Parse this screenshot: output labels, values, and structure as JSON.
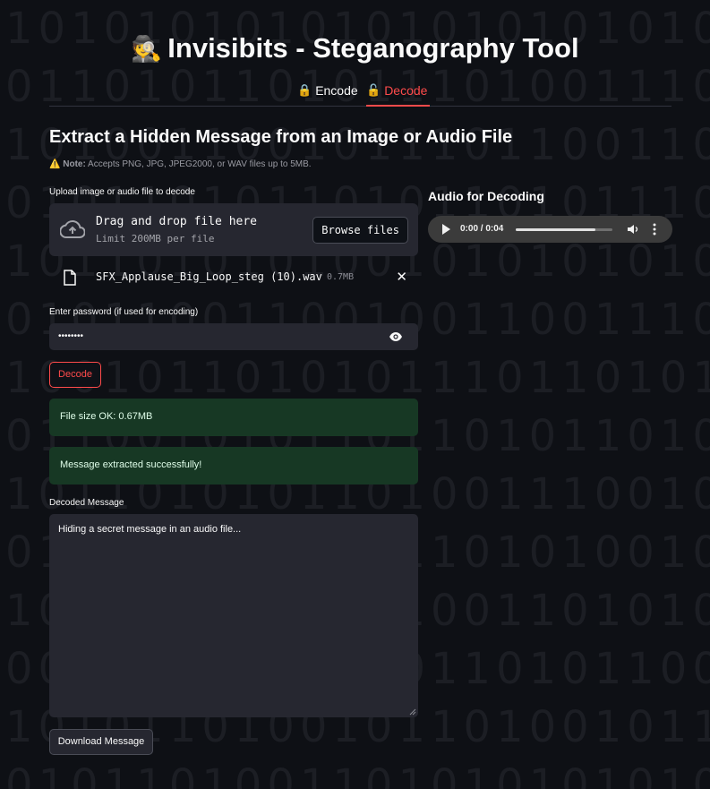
{
  "background_pattern": [
    "1 0 1 0 1 0 1 0 1 0 1 0 1 0 1 0 1 0 1 0 1 0 1",
    "0 1 1 0 1 0 1 1 0 1 0 1 1 1 0 1 0 0 1 1 1 0 1",
    "1 0 1 0 0 1 1 0 0 1 0 1 1 1 0 1 1 0 0 1 1 0 1",
    "0 1 0 1 1 0 1 0 1 1 0 1 0 1 1 0 1 0 1 1 1 0 0",
    "1 0 1 1 0 1 0 1 0 1 0 0 1 0 1 0 1 0 1 0 1 0 1",
    "0 1 0 1 1 0 0 1 1 0 0 1 0 0 1 1 0 0 1 1 1 0 0",
    "1 0 0 1 0 1 1 0 1 0 1 0 1 1 1 0 1 1 0 1 0 1 1",
    "0 1 1 0 0 1 0 1 0 1 1 0 1 1 0 1 0 1 1 0 1 0 1",
    "1 0 1 1 0 1 0 1 0 1 1 0 1 0 0 1 1 1 0 0 1 0 1",
    "0 1 0 1 1 0 1 0 1 0 1 0 1 1 0 1 0 1 0 0 1 0 1",
    "1 0 0 0 1 1 1 0 1 0 1 0 1 0 0 1 1 0 1 0 1 0 1",
    "0 0 1 0 1 0 1 0 1 1 0 1 0 1 1 0 1 0 1 1 0 0 1",
    "1 0 1 0 1 1 0 1 0 0 1 0 1 1 0 1 0 0 1 0 1 1 1",
    "0 1 0 1 1 0 1 0 0 1 1 0 1 0 1 0 1 0 1 0 1 0 1"
  ],
  "header": {
    "emoji": "🕵️",
    "title": "Invisibits - Steganography Tool"
  },
  "tabs": [
    {
      "icon": "🔒",
      "label": "Encode",
      "active": false
    },
    {
      "icon": "🔓",
      "label": "Decode",
      "active": true
    }
  ],
  "main": {
    "heading": "Extract a Hidden Message from an Image or Audio File",
    "note_icon": "⚠️",
    "note_bold": "Note:",
    "note_text": " Accepts PNG, JPG, JPEG2000, or WAV files up to 5MB.",
    "upload_label": "Upload image or audio file to decode",
    "dropzone_title": "Drag and drop file here",
    "dropzone_limit": "Limit 200MB per file",
    "browse_label": "Browse files",
    "file_name": "SFX_Applause_Big_Loop_steg (10).wav",
    "file_size": "0.7MB",
    "password_label": "Enter password (if used for encoding)",
    "password_value": "••••••••",
    "decode_button": "Decode",
    "alert_size": "File size OK: 0.67MB",
    "alert_success": "Message extracted successfully!",
    "decoded_label": "Decoded Message",
    "decoded_value": "Hiding a secret message in an audio file...",
    "download_button": "Download Message"
  },
  "audio": {
    "heading": "Audio for Decoding",
    "time": "0:00 / 0:04",
    "progress": 0.82
  },
  "colors": {
    "background": "#0e1015",
    "accent": "#ff4b4b",
    "input_bg": "#262730",
    "success_bg": "#173824",
    "success_text": "#dffde9"
  }
}
